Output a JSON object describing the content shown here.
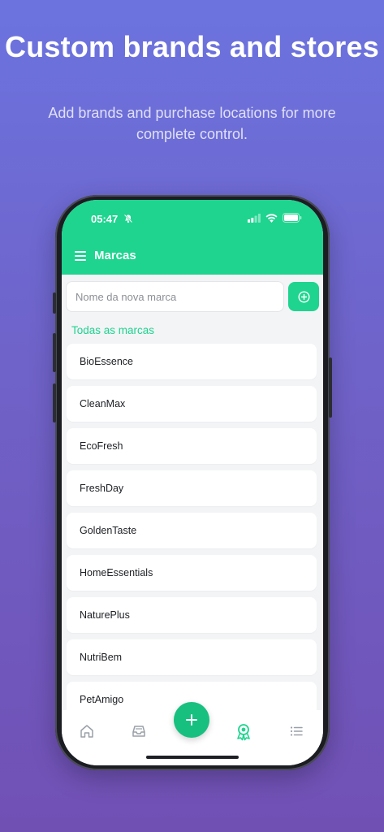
{
  "promo": {
    "title": "Custom brands and stores",
    "subtitle": "Add brands and purchase locations for more complete control."
  },
  "status_bar": {
    "time": "05:47"
  },
  "header": {
    "title": "Marcas"
  },
  "new_brand": {
    "placeholder": "Nome da nova marca",
    "value": ""
  },
  "section": {
    "label": "Todas as marcas"
  },
  "brands": [
    "BioEssence",
    "CleanMax",
    "EcoFresh",
    "FreshDay",
    "GoldenTaste",
    "HomeEssentials",
    "NaturePlus",
    "NutriBem",
    "PetAmigo"
  ],
  "tabbar": {
    "tabs": [
      {
        "icon": "home-icon",
        "active": false
      },
      {
        "icon": "inbox-icon",
        "active": false
      },
      {
        "icon": "plus-icon",
        "active": false
      },
      {
        "icon": "award-icon",
        "active": true
      },
      {
        "icon": "list-icon",
        "active": false
      }
    ]
  },
  "colors": {
    "accent": "#1ed48f",
    "background_top": "#6c73df",
    "background_bottom": "#7150b4",
    "inactive_icon": "#9aa0a8"
  }
}
